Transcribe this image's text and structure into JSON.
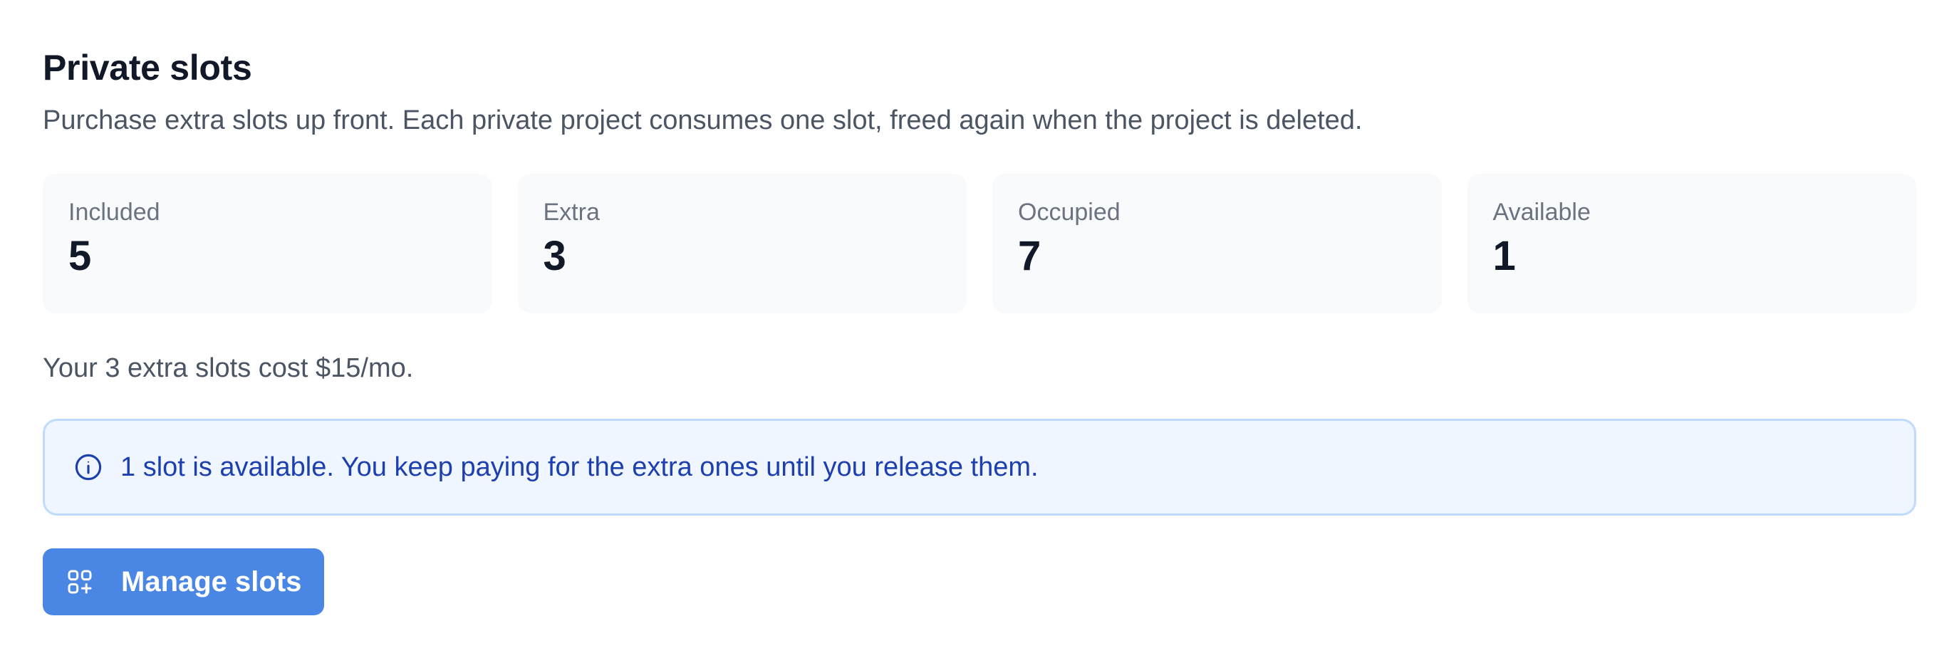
{
  "header": {
    "title": "Private slots",
    "subtitle": "Purchase extra slots up front. Each private project consumes one slot, freed again when the project is deleted."
  },
  "stats": [
    {
      "label": "Included",
      "value": "5"
    },
    {
      "label": "Extra",
      "value": "3"
    },
    {
      "label": "Occupied",
      "value": "7"
    },
    {
      "label": "Available",
      "value": "1"
    }
  ],
  "cost_text": "Your 3 extra slots cost $15/mo.",
  "notice": {
    "icon": "info-icon",
    "text": "1 slot is available. You keep paying for the extra ones until you release them."
  },
  "manage_button": {
    "icon": "grid-plus-icon",
    "label": "Manage slots"
  },
  "colors": {
    "title": "#111827",
    "muted_text": "#4b5563",
    "stat_card_bg": "#f8fafc",
    "notice_bg": "#eff6ff",
    "notice_border": "#bfdbfe",
    "notice_text": "#1e40af",
    "button_bg": "#4a86e3",
    "button_text": "#ffffff"
  }
}
